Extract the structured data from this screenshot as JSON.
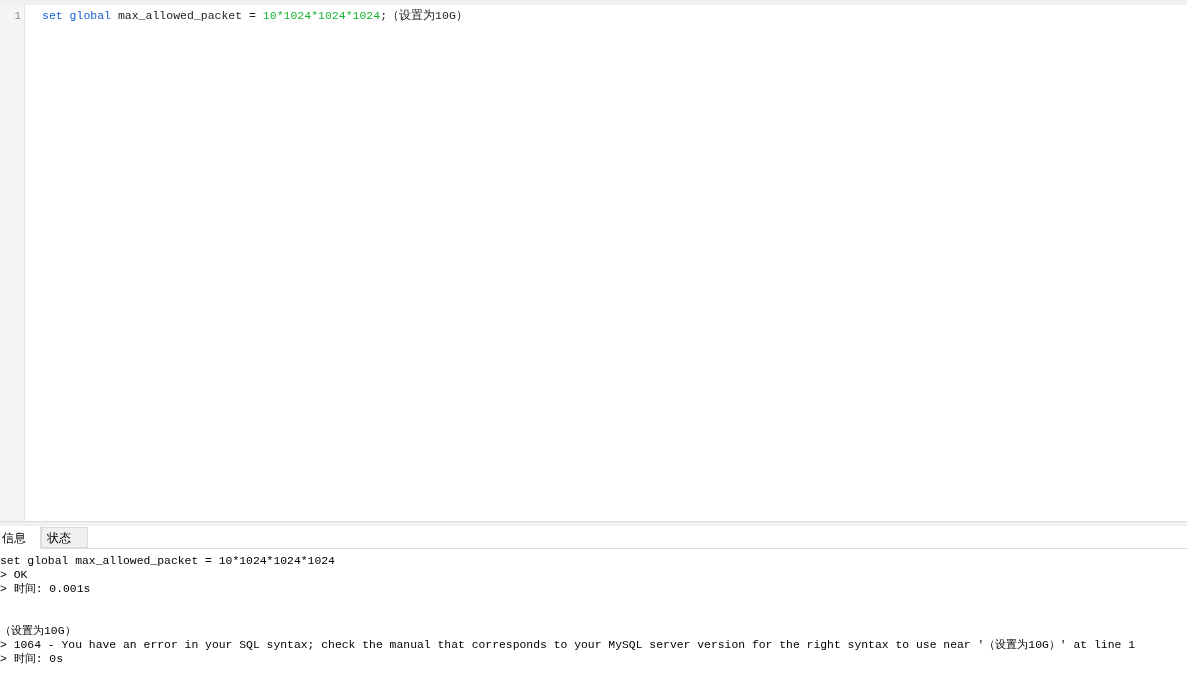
{
  "editor": {
    "lines": [
      {
        "number": "1",
        "tokens": [
          {
            "kind": "keyword",
            "text": "set global"
          },
          {
            "kind": "plain",
            "text": " max_allowed_packet = "
          },
          {
            "kind": "number",
            "text": "10*1024*1024*1024"
          },
          {
            "kind": "plain",
            "text": ";（设置为10G）"
          }
        ]
      }
    ]
  },
  "tabs": [
    {
      "label": "信息",
      "selected": true
    },
    {
      "label": "状态",
      "selected": false
    }
  ],
  "messages": [
    {
      "lines": [
        "set global max_allowed_packet = 10*1024*1024*1024",
        "> OK",
        "> 时间: 0.001s"
      ]
    },
    {
      "lines": [
        "（设置为10G）",
        "> 1064 - You have an error in your SQL syntax; check the manual that corresponds to your MySQL server version for the right syntax to use near '（设置为10G）' at line 1",
        "> 时间: 0s"
      ]
    }
  ]
}
